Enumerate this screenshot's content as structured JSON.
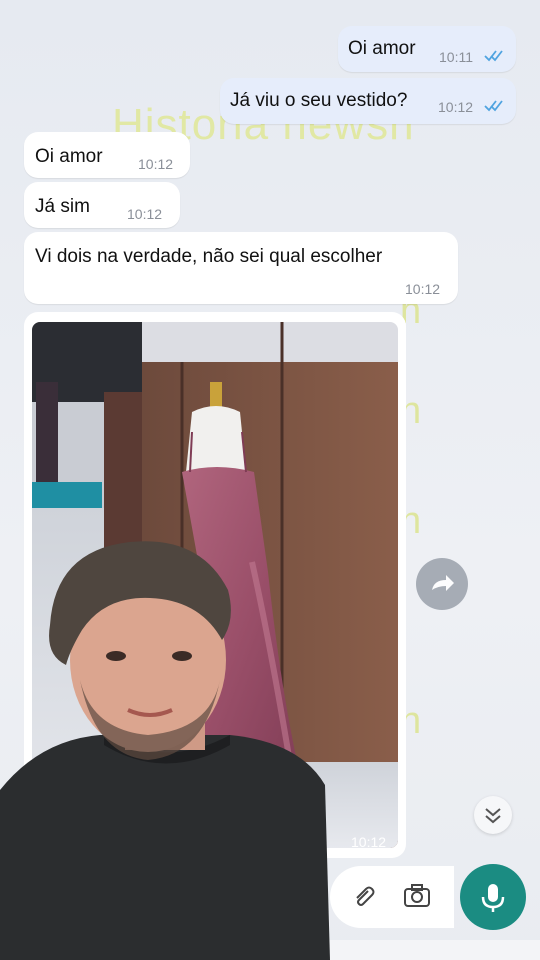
{
  "watermark": {
    "text": "Historia newsh"
  },
  "messages": [
    {
      "text": "Oi amor",
      "time": "10:11",
      "dir": "out"
    },
    {
      "text": "Já viu o seu vestido?",
      "time": "10:12",
      "dir": "out"
    },
    {
      "text": "Oi amor",
      "time": "10:12",
      "dir": "in"
    },
    {
      "text": "Já sim",
      "time": "10:12",
      "dir": "in"
    },
    {
      "text": "Vi dois na verdade, não sei qual escolher",
      "time": "10:12",
      "dir": "in"
    }
  ],
  "image_message": {
    "time": "10:12",
    "subject": "pink satin dress on mannequin"
  },
  "colors": {
    "outgoing": "#e6edfb",
    "incoming": "#ffffff",
    "mic": "#1b8c82",
    "ticks": "#4fa3e0"
  }
}
